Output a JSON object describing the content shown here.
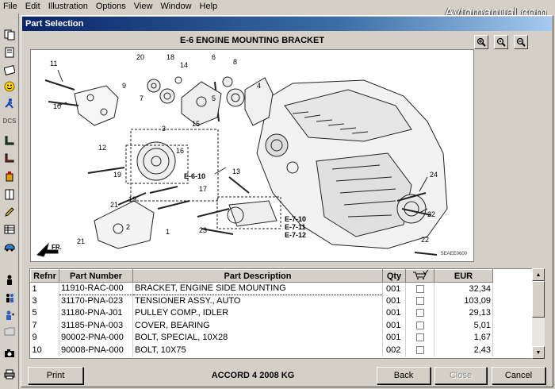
{
  "menu": [
    "File",
    "Edit",
    "Illustration",
    "Options",
    "View",
    "Window",
    "Help"
  ],
  "watermark": "Avtomanual.com",
  "window": {
    "title": "Part Selection",
    "figure_title": "E-6 ENGINE MOUNTING BRACKET",
    "figure_code": "SEAEE0600"
  },
  "callouts": {
    "numbers": [
      "11",
      "10",
      "20",
      "18",
      "9",
      "7",
      "14",
      "6",
      "8",
      "5",
      "3",
      "15",
      "12",
      "16",
      "19",
      "19",
      "13",
      "17",
      "21",
      "21",
      "23",
      "22",
      "24",
      "22",
      "22",
      "4",
      "2",
      "1"
    ],
    "refs": [
      "E-6-10",
      "E-7-10",
      "E-7-11",
      "E-7-12"
    ],
    "fr": "FR."
  },
  "table": {
    "columns": [
      "Refnr",
      "Part Number",
      "Part Description",
      "Qty",
      "",
      "EUR"
    ],
    "rows": [
      {
        "refnr": "1",
        "part_number": "11910-RAC-000",
        "description": "BRACKET, ENGINE SIDE MOUNTING",
        "qty": "001",
        "eur": "32,34"
      },
      {
        "refnr": "3",
        "part_number": "31170-PNA-023",
        "description": "TENSIONER ASSY., AUTO",
        "qty": "001",
        "eur": "103,09"
      },
      {
        "refnr": "5",
        "part_number": "31180-PNA-J01",
        "description": "PULLEY COMP., IDLER",
        "qty": "001",
        "eur": "29,13"
      },
      {
        "refnr": "7",
        "part_number": "31185-PNA-003",
        "description": "COVER, BEARING",
        "qty": "001",
        "eur": "5,01"
      },
      {
        "refnr": "9",
        "part_number": "90002-PNA-000",
        "description": "BOLT, SPECIAL, 10X28",
        "qty": "001",
        "eur": "1,67"
      },
      {
        "refnr": "10",
        "part_number": "90008-PNA-000",
        "description": "BOLT, 10X75",
        "qty": "002",
        "eur": "2,43"
      }
    ]
  },
  "buttons": {
    "print": "Print",
    "back": "Back",
    "close": "Close",
    "cancel": "Cancel"
  },
  "model": "ACCORD  4  2008  KG",
  "icons": [
    "zoom-in-icon",
    "zoom-actual-icon",
    "zoom-out-icon",
    "cart-check-icon"
  ]
}
